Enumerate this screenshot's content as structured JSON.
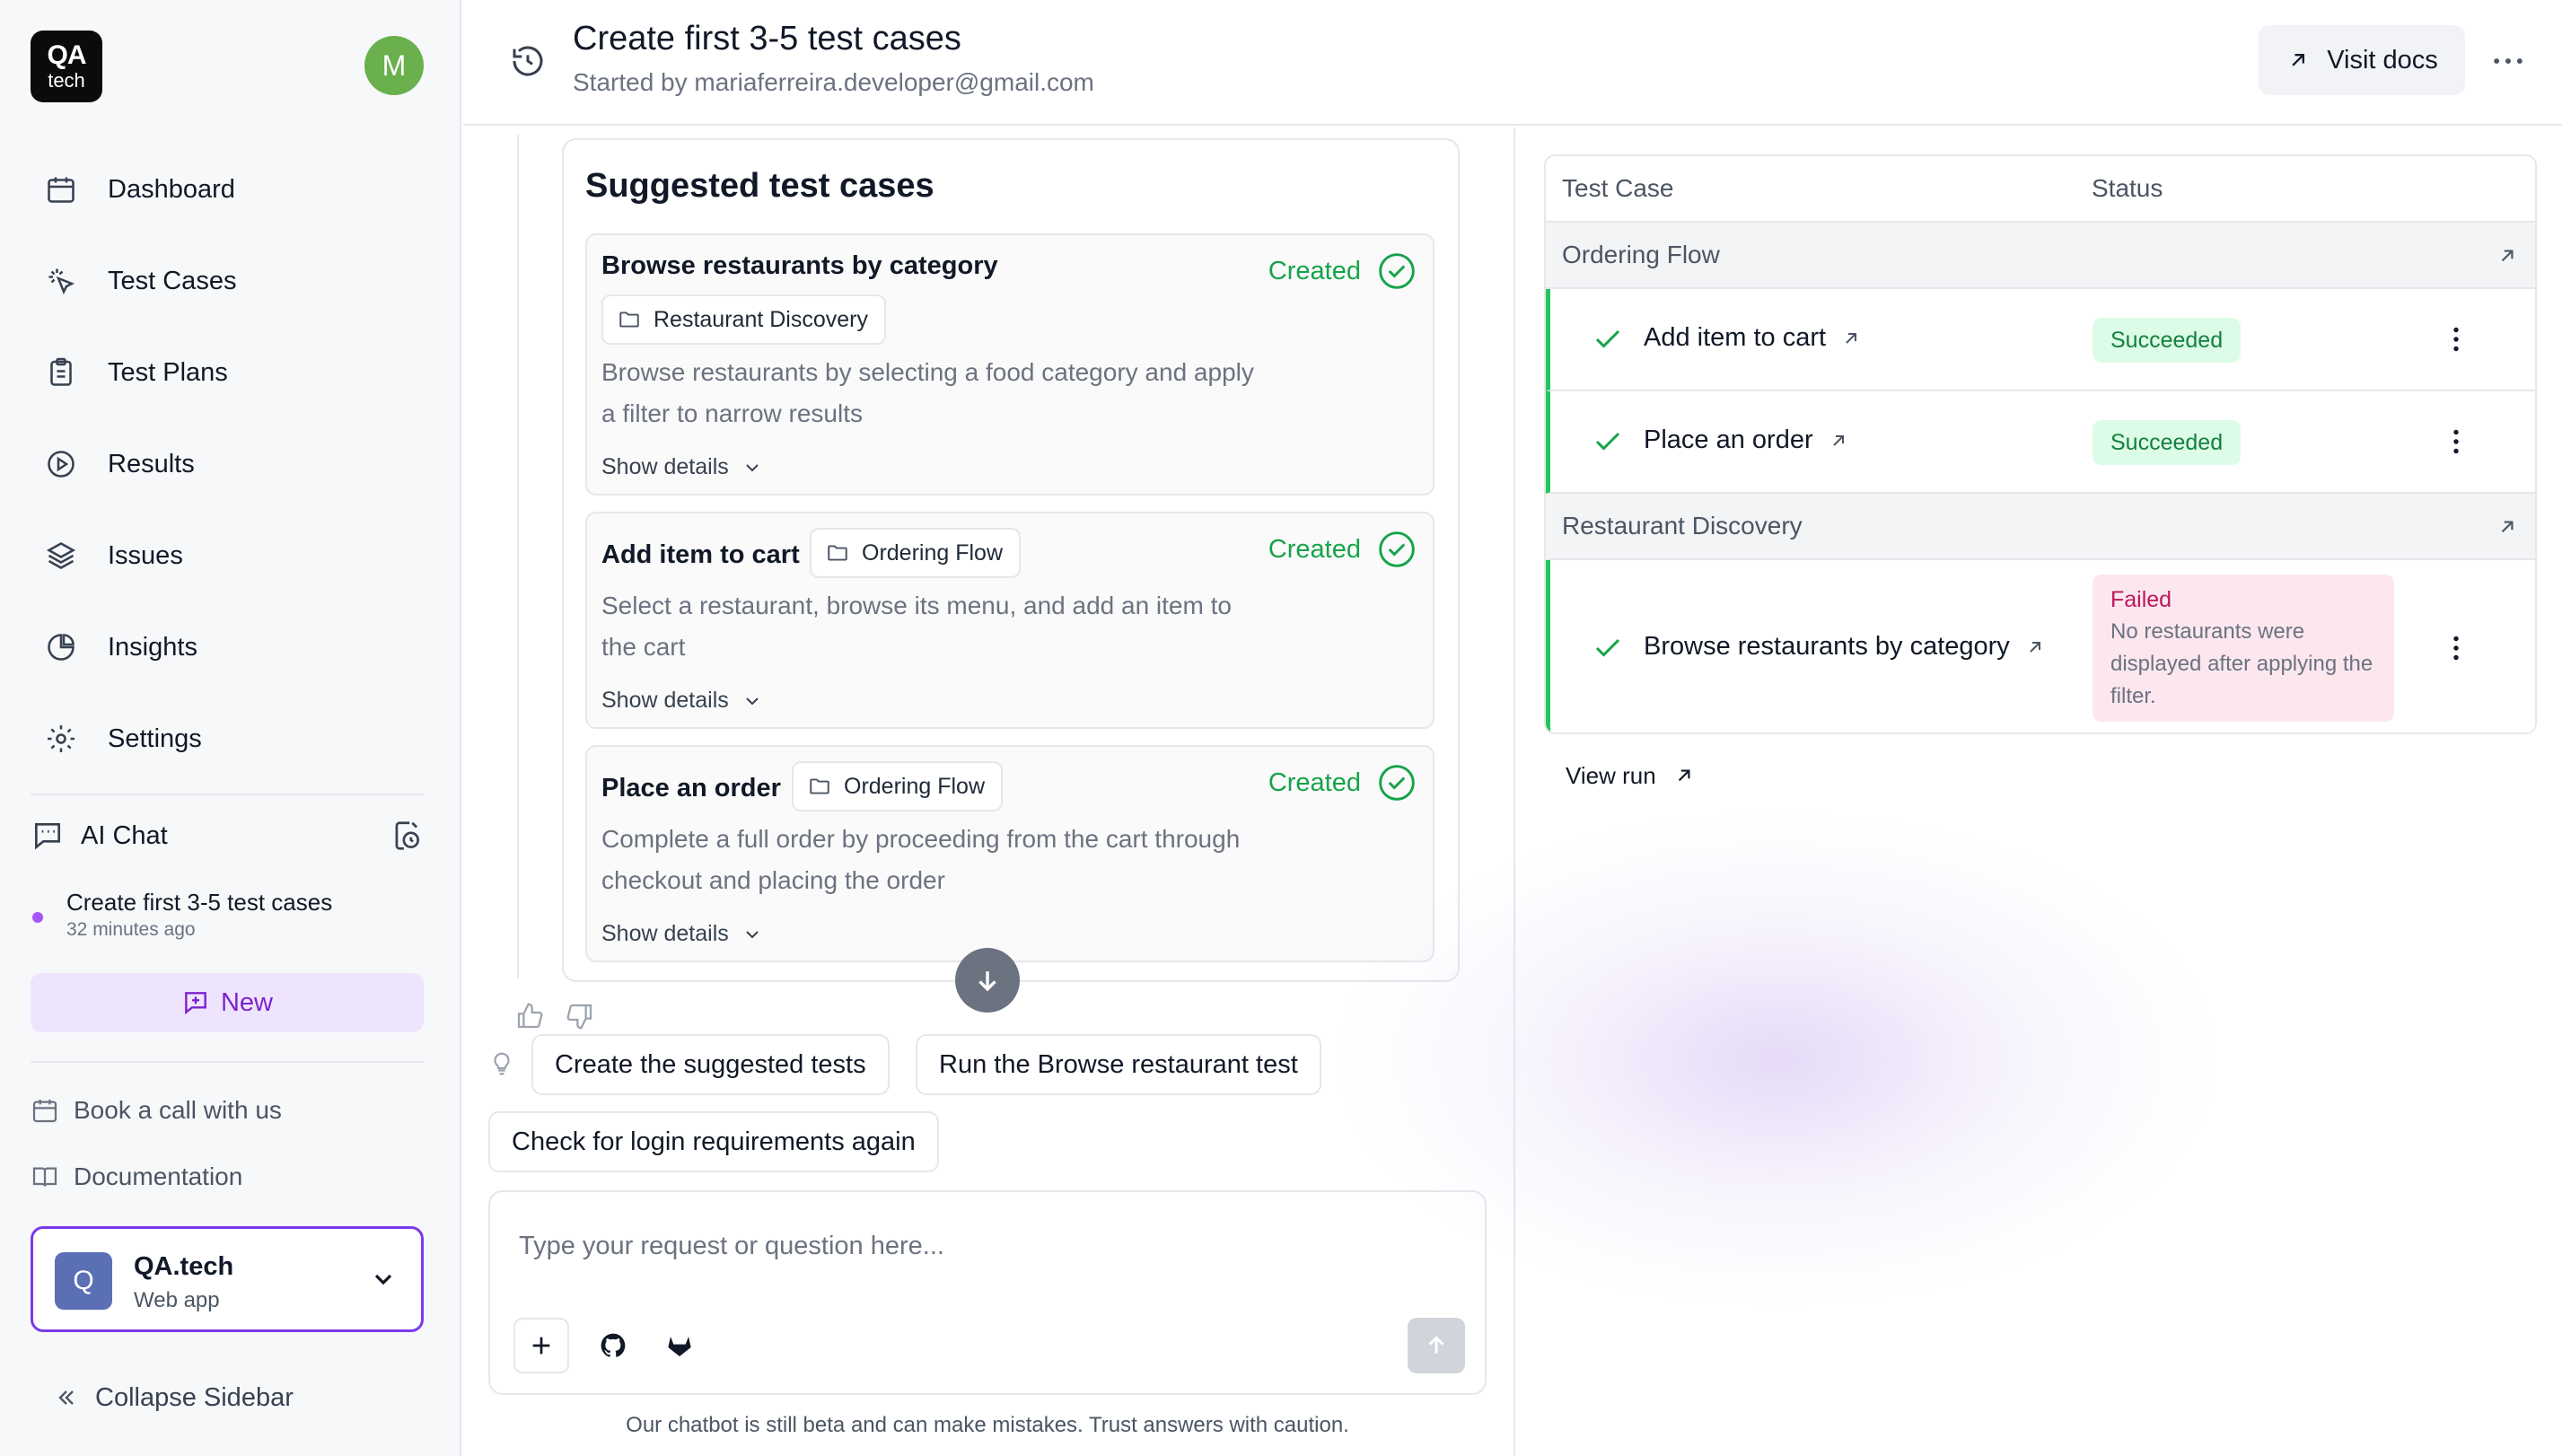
{
  "sidebar": {
    "logo": {
      "line1": "QA",
      "line2": "tech"
    },
    "avatar_initial": "M",
    "nav": [
      {
        "label": "Dashboard",
        "icon": "calendar-icon"
      },
      {
        "label": "Test Cases",
        "icon": "sparkle-cursor-icon"
      },
      {
        "label": "Test Plans",
        "icon": "clipboard-icon"
      },
      {
        "label": "Results",
        "icon": "play-circle-icon"
      },
      {
        "label": "Issues",
        "icon": "layers-icon"
      },
      {
        "label": "Insights",
        "icon": "pie-chart-icon"
      },
      {
        "label": "Settings",
        "icon": "gear-icon"
      }
    ],
    "ai_chat": {
      "title": "AI Chat",
      "recent": {
        "title": "Create first 3-5 test cases",
        "time": "32 minutes ago"
      },
      "new_label": "New"
    },
    "links": [
      {
        "label": "Book a call with us",
        "icon": "calendar-icon"
      },
      {
        "label": "Documentation",
        "icon": "book-icon"
      }
    ],
    "workspace": {
      "initial": "Q",
      "name": "QA.tech",
      "type": "Web app"
    },
    "collapse_label": "Collapse Sidebar"
  },
  "header": {
    "title": "Create first 3-5 test cases",
    "subtitle": "Started by mariaferreira.developer@gmail.com",
    "visit_docs": "Visit docs"
  },
  "chat": {
    "suggested": {
      "heading": "Suggested test cases",
      "cases": [
        {
          "name": "Browse restaurants by category",
          "tag": "Restaurant Discovery",
          "status": "Created",
          "description": "Browse restaurants by selecting a food category and apply a filter to narrow results",
          "details_label": "Show details"
        },
        {
          "name": "Add item to cart",
          "tag": "Ordering Flow",
          "status": "Created",
          "description": "Select a restaurant, browse its menu, and add an item to the cart",
          "details_label": "Show details"
        },
        {
          "name": "Place an order",
          "tag": "Ordering Flow",
          "status": "Created",
          "description": "Complete a full order by proceeding from the cart through checkout and placing the order",
          "details_label": "Show details"
        }
      ]
    },
    "suggestions": [
      "Create the suggested tests",
      "Run the Browse restaurant test",
      "Check for login requirements again"
    ],
    "composer": {
      "placeholder": "Type your request or question here..."
    },
    "disclaimer": "Our chatbot is still beta and can make mistakes. Trust answers with caution."
  },
  "results": {
    "columns": [
      "Test Case",
      "Status"
    ],
    "groups": [
      {
        "name": "Ordering Flow",
        "cases": [
          {
            "name": "Add item to cart",
            "status": "Succeeded"
          },
          {
            "name": "Place an order",
            "status": "Succeeded"
          }
        ]
      },
      {
        "name": "Restaurant Discovery",
        "cases": [
          {
            "name": "Browse restaurants by category",
            "status": "Failed",
            "message": "No restaurants were displayed after applying the filter."
          }
        ]
      }
    ],
    "view_run_label": "View run"
  },
  "colors": {
    "accent_purple": "#7c3aed",
    "success_green": "#16a34a",
    "failed_pink": "#be185d",
    "avatar_green": "#6ab04c"
  }
}
